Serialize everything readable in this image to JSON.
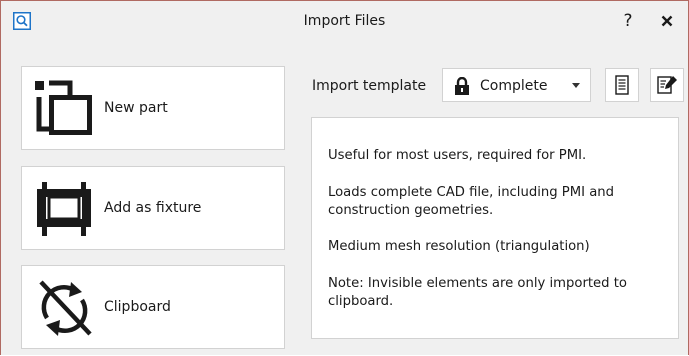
{
  "window": {
    "title": "Import Files",
    "help_label": "?",
    "accent_color": "#1e74c8",
    "border_color": "#b06a62"
  },
  "icons": {
    "app": "search-icon",
    "help": "help-icon",
    "close": "close-icon",
    "new_part": "new-part-icon",
    "fixture": "fixture-icon",
    "clipboard": "clipboard-sync-off-icon",
    "lock": "lock-icon",
    "caret": "chevron-down-icon",
    "list": "document-list-icon",
    "edit": "edit-document-icon"
  },
  "actions": [
    {
      "label": "New part"
    },
    {
      "label": "Add as fixture"
    },
    {
      "label": "Clipboard"
    }
  ],
  "template": {
    "label": "Import template",
    "selected": "Complete"
  },
  "description": [
    "Useful for most users, required for PMI.",
    "Loads complete CAD file, including PMI and construction geometries.",
    "Medium mesh resolution (triangulation)",
    "Note: Invisible elements are only imported to clipboard."
  ]
}
